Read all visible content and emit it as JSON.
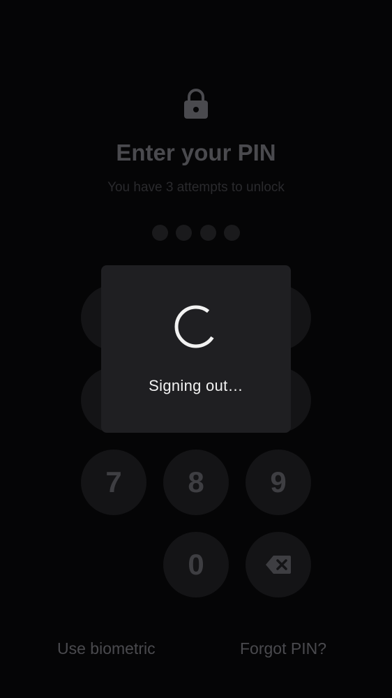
{
  "lock_screen": {
    "icon": "lock-icon",
    "title": "Enter your PIN",
    "subtitle": "You have 3 attempts to unlock",
    "pin_length": 4,
    "pin_entered": 0
  },
  "keypad": {
    "keys": [
      "7",
      "8",
      "9",
      "0"
    ],
    "backspace_icon": "backspace-icon"
  },
  "footer": {
    "biometric_label": "Use biometric",
    "forgot_label": "Forgot PIN?"
  },
  "dialog": {
    "message": "Signing out…",
    "spinner_icon": "spinner-icon"
  },
  "colors": {
    "background": "#050506",
    "dialog_background": "#1f1f22",
    "dimmed_text": "#4a4a4e",
    "key_background": "#141416"
  }
}
